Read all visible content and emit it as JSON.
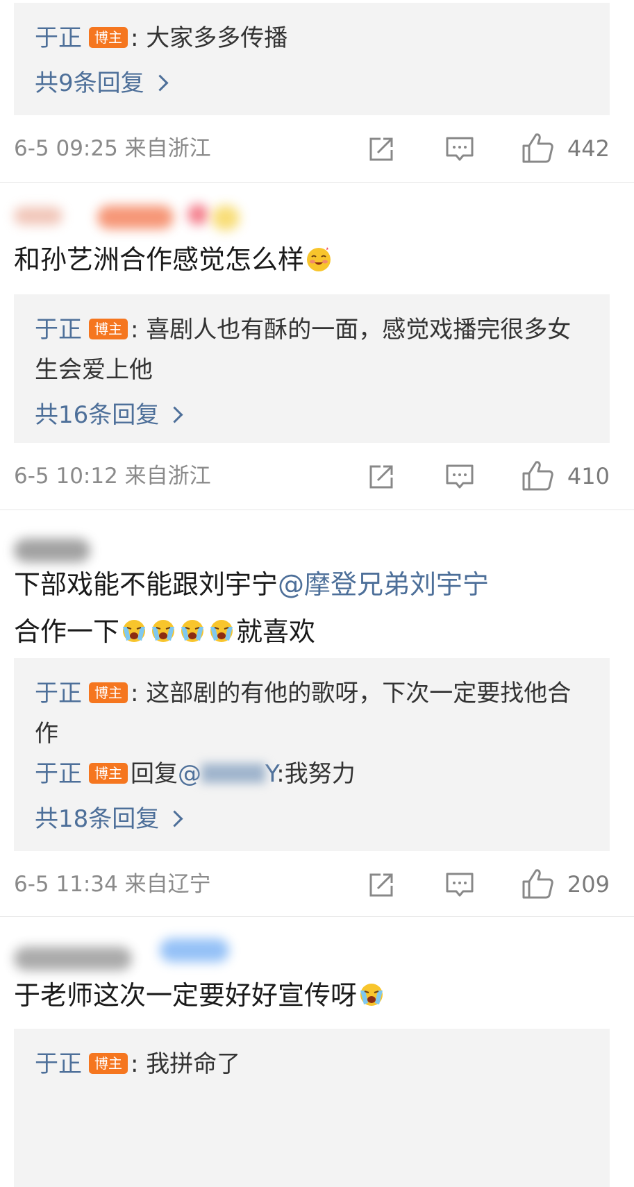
{
  "badge_label": "博主",
  "threads": [
    {
      "comment_text": "",
      "replies": [
        {
          "author": "于正",
          "separator": ":",
          "text": "大家多多传播"
        }
      ],
      "reply_count": "共9条回复",
      "time": "6-5 09:25 来自浙江",
      "likes": "442"
    },
    {
      "comment_text": "和孙艺洲合作感觉怎么样",
      "replies": [
        {
          "author": "于正",
          "separator": ":",
          "text": "喜剧人也有酥的一面，感觉戏播完很多女生会爱上他"
        }
      ],
      "reply_count": "共16条回复",
      "time": "6-5 10:12 来自浙江",
      "likes": "410"
    },
    {
      "comment_text_1": "下部戏能不能跟刘宇宁",
      "mention": "@摩登兄弟刘宇宁",
      "comment_text_2": "合作一下",
      "comment_text_3": "就喜欢",
      "replies": [
        {
          "author": "于正",
          "separator": ":",
          "text": "这部剧的有他的歌呀，下次一定要找他合作"
        },
        {
          "author": "于正",
          "reply_prefix": "回复",
          "reply_target": "@",
          "reply_target_tail": "Y",
          "text": ":我努力"
        }
      ],
      "reply_count": "共18条回复",
      "time": "6-5 11:34 来自辽宁",
      "likes": "209"
    },
    {
      "comment_text": "于老师这次一定要好好宣传呀",
      "replies": [
        {
          "author": "于正",
          "separator": ":",
          "text": "我拼命了"
        }
      ]
    }
  ],
  "icons": {
    "share": "share-icon",
    "comment": "comment-icon",
    "like": "thumbs-up-icon",
    "emoji_smile": "smiling-face-emoji",
    "emoji_cry": "crying-face-emoji"
  },
  "colors": {
    "author": "#4d6f99",
    "badge": "#f5761f",
    "reply_bg": "#f3f3f3",
    "meta": "#8a8a8a"
  }
}
